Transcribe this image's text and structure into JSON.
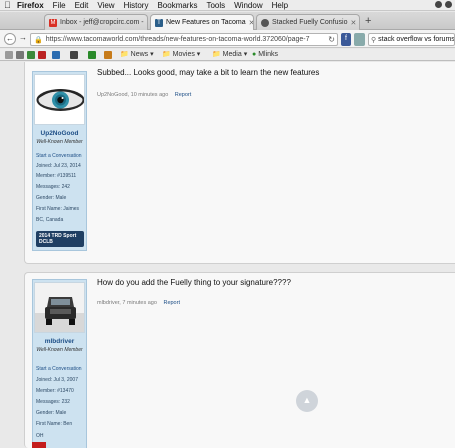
{
  "menubar": {
    "app": "Firefox",
    "items": [
      "File",
      "Edit",
      "View",
      "History",
      "Bookmarks",
      "Tools",
      "Window",
      "Help"
    ]
  },
  "tabs": [
    {
      "label": "Inbox - jeff@cropcirc.com -",
      "icon": "gmail-icon",
      "color": "#d93025",
      "active": false
    },
    {
      "label": "New Features on Tacoma",
      "icon": "site-favicon",
      "color": "#2c5f8a",
      "active": true
    },
    {
      "label": "Stacked Fuelly Confusio",
      "icon": "stackoverflow-icon",
      "color": "#555555",
      "active": false
    }
  ],
  "navbar": {
    "url": "https://www.tacomaworld.com/threads/new-features-on-tacoma-world.372060/page-7",
    "search": "stack overflow vs forums"
  },
  "bookmarks": [
    {
      "label": "News",
      "kind": "folder"
    },
    {
      "label": "Movies",
      "kind": "folder"
    },
    {
      "label": "Media",
      "kind": "folder"
    },
    {
      "label": "Mlinks",
      "kind": "link"
    }
  ],
  "posts": [
    {
      "username": "Up2NoGood",
      "title": "Well-Known Member",
      "start_conversation": "Start a Conversation",
      "info": [
        "Joined: Jul 23, 2014",
        "Member: #139511",
        "Messages: 242",
        "Gender: Male",
        "First Name: Jaimes",
        "BC, Canada"
      ],
      "badge": "2014 TRD Sport DCLB",
      "message": "Subbed... Looks good, may take a bit to learn the new features",
      "meta_author": "Up2NoGood,",
      "meta_time": "10 minutes ago",
      "reply": "Report"
    },
    {
      "username": "mlbdriver",
      "title": "Well-Known Member",
      "start_conversation": "Start a Conversation",
      "info": [
        "Joined: Jul 3, 2007",
        "Member: #13470",
        "Messages: 232",
        "Gender: Male",
        "First Name: Ben",
        "OH"
      ],
      "message": "How do you add the Fuelly thing to your signature????",
      "meta_author": "mlbdriver,",
      "meta_time": "7 minutes ago",
      "reply": "Report"
    }
  ],
  "colors": {
    "link": "#1d4e86",
    "panel": "#cde2f0",
    "badge": "#1f3f63"
  }
}
